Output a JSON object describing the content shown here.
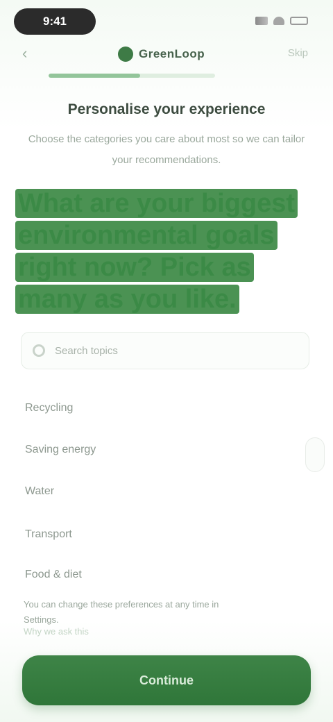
{
  "status_bar": {
    "time": "9:41"
  },
  "nav": {
    "back_icon": "chevron-left-icon",
    "logo_icon": "leaf-icon",
    "title": "GreenLoop",
    "skip_label": "Skip"
  },
  "progress": {
    "fraction": 0.55
  },
  "step": {
    "title": "Personalise your experience",
    "subtitle": "Choose the categories you care about most so we can tailor your recommendations."
  },
  "headline": {
    "text": "What are your biggest environmental goals right now? Pick as many as you like."
  },
  "search": {
    "placeholder": "Search topics",
    "value": ""
  },
  "options": [
    {
      "label": "Recycling"
    },
    {
      "label": "Saving energy"
    },
    {
      "label": "Water"
    },
    {
      "label": "Transport"
    },
    {
      "label": "Food & diet"
    }
  ],
  "footer": {
    "terms": "You can change these preferences at any time in Settings.",
    "learn_more": "Why we ask this"
  },
  "cta": {
    "label": "Continue"
  },
  "colors": {
    "brand": "#3b8a46",
    "brand_dark": "#2f7639",
    "accent_light": "#93c59a"
  }
}
